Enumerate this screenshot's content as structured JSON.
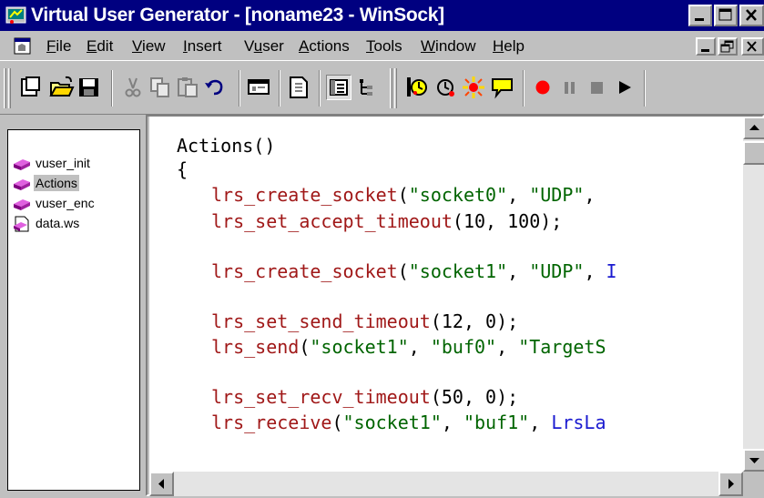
{
  "window": {
    "title": "Virtual User Generator - [noname23 - WinSock]"
  },
  "menu": {
    "items": [
      {
        "prefix": "",
        "hotkey": "F",
        "rest": "ile"
      },
      {
        "prefix": "",
        "hotkey": "E",
        "rest": "dit"
      },
      {
        "prefix": "",
        "hotkey": "V",
        "rest": "iew"
      },
      {
        "prefix": "",
        "hotkey": "I",
        "rest": "nsert"
      },
      {
        "prefix": "V",
        "hotkey": "u",
        "rest": "ser"
      },
      {
        "prefix": "",
        "hotkey": "A",
        "rest": "ctions"
      },
      {
        "prefix": "",
        "hotkey": "T",
        "rest": "ools"
      },
      {
        "prefix": "",
        "hotkey": "W",
        "rest": "indow"
      },
      {
        "prefix": "",
        "hotkey": "H",
        "rest": "elp"
      }
    ]
  },
  "toolbar": {
    "icons": [
      "new-script-icon",
      "open-folder-icon",
      "save-disk-icon",
      "cut-scissors-icon",
      "copy-icon",
      "paste-icon",
      "undo-arrow-icon",
      "compile-icon",
      "script-view-icon",
      "list-view-icon",
      "tree-view-icon",
      "record-into-action-icon",
      "record-icon",
      "run-icon",
      "comment-icon",
      "record-dot-icon",
      "pause-icon",
      "stop-icon",
      "play-icon"
    ]
  },
  "sidebar": {
    "items": [
      {
        "label": "vuser_init",
        "icon": "action-brick-icon",
        "selected": false
      },
      {
        "label": "Actions",
        "icon": "action-brick-icon",
        "selected": true
      },
      {
        "label": "vuser_enc",
        "icon": "action-brick-icon",
        "selected": false
      },
      {
        "label": "data.ws",
        "icon": "data-file-icon",
        "selected": false
      }
    ]
  },
  "editor": {
    "header": "Actions()",
    "open_brace": "{",
    "lines": [
      {
        "fn": "lrs_create_socket",
        "open": "(",
        "args": [
          {
            "t": "s",
            "v": "\"socket0\""
          },
          {
            "t": "p",
            "v": ", "
          },
          {
            "t": "s",
            "v": "\"UDP\""
          },
          {
            "t": "p",
            "v": ", "
          }
        ]
      },
      {
        "fn": "lrs_set_accept_timeout",
        "open": "(",
        "args": [
          {
            "t": "p",
            "v": "10, 100);"
          }
        ]
      },
      {
        "fn": "lrs_create_socket",
        "open": "(",
        "args": [
          {
            "t": "s",
            "v": "\"socket1\""
          },
          {
            "t": "p",
            "v": ", "
          },
          {
            "t": "s",
            "v": "\"UDP\""
          },
          {
            "t": "p",
            "v": ", "
          },
          {
            "t": "c",
            "v": "I"
          }
        ]
      },
      {
        "fn": "lrs_set_send_timeout",
        "open": "(",
        "args": [
          {
            "t": "p",
            "v": "12, 0);"
          }
        ]
      },
      {
        "fn": "lrs_send",
        "open": "(",
        "args": [
          {
            "t": "s",
            "v": "\"socket1\""
          },
          {
            "t": "p",
            "v": ", "
          },
          {
            "t": "s",
            "v": "\"buf0\""
          },
          {
            "t": "p",
            "v": ", "
          },
          {
            "t": "s",
            "v": "\"TargetS"
          }
        ]
      },
      {
        "fn": "lrs_set_recv_timeout",
        "open": "(",
        "args": [
          {
            "t": "p",
            "v": "50, 0);"
          }
        ]
      },
      {
        "fn": "lrs_receive",
        "open": "(",
        "args": [
          {
            "t": "s",
            "v": "\"socket1\""
          },
          {
            "t": "p",
            "v": ", "
          },
          {
            "t": "s",
            "v": "\"buf1\""
          },
          {
            "t": "p",
            "v": ", "
          },
          {
            "t": "c",
            "v": "LrsLa"
          }
        ]
      }
    ]
  },
  "colors": {
    "title_bar": "#000080",
    "function": "#a01818",
    "string": "#006400",
    "constant": "#1a1ad0"
  }
}
